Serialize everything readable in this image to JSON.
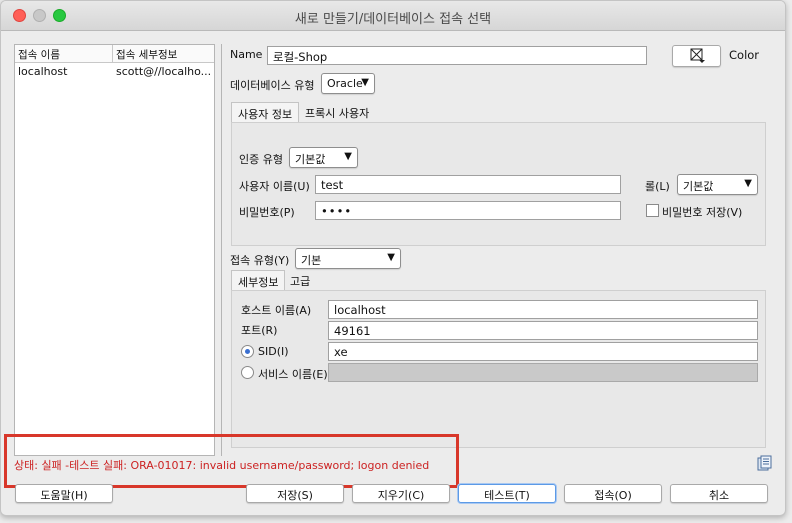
{
  "window": {
    "title": "새로 만들기/데이터베이스 접속 선택"
  },
  "connections": {
    "headers": [
      "접속 이름",
      "접속 세부정보"
    ],
    "rows": [
      {
        "name": "localhost",
        "details": "scott@//localho..."
      }
    ]
  },
  "name": {
    "label": "Name",
    "value": "로컬-Shop"
  },
  "color": {
    "label": "Color",
    "icon": "color-picker-icon"
  },
  "db_type": {
    "label": "데이터베이스 유형",
    "value": "Oracle"
  },
  "user_tabs": [
    "사용자 정보",
    "프록시 사용자"
  ],
  "auth": {
    "label": "인증 유형",
    "value": "기본값"
  },
  "username": {
    "label": "사용자 이름(U)",
    "value": "test"
  },
  "role": {
    "label": "롤(L)",
    "value": "기본값"
  },
  "password": {
    "label": "비밀번호(P)",
    "value": "••••"
  },
  "save_password": {
    "label": "비밀번호 저장(V)",
    "checked": false
  },
  "conn_type": {
    "label": "접속 유형(Y)",
    "value": "기본"
  },
  "detail_tabs": [
    "세부정보",
    "고급"
  ],
  "host": {
    "label": "호스트 이름(A)",
    "value": "localhost"
  },
  "port": {
    "label": "포트(R)",
    "value": "49161"
  },
  "sid": {
    "label": "SID(I)",
    "value": "xe",
    "selected": true
  },
  "service": {
    "label": "서비스 이름(E)",
    "value": "",
    "selected": false
  },
  "status": {
    "text": "상태: 실패 -테스트 실패: ORA-01017: invalid username/password; logon denied"
  },
  "buttons": {
    "help": "도움말(H)",
    "save": "저장(S)",
    "clear": "지우기(C)",
    "test": "테스트(T)",
    "connect": "접속(O)",
    "cancel": "취소"
  },
  "colors": {
    "status_error": "#cc2222",
    "highlight": "#d8372a",
    "focus": "#5c9ae6"
  }
}
